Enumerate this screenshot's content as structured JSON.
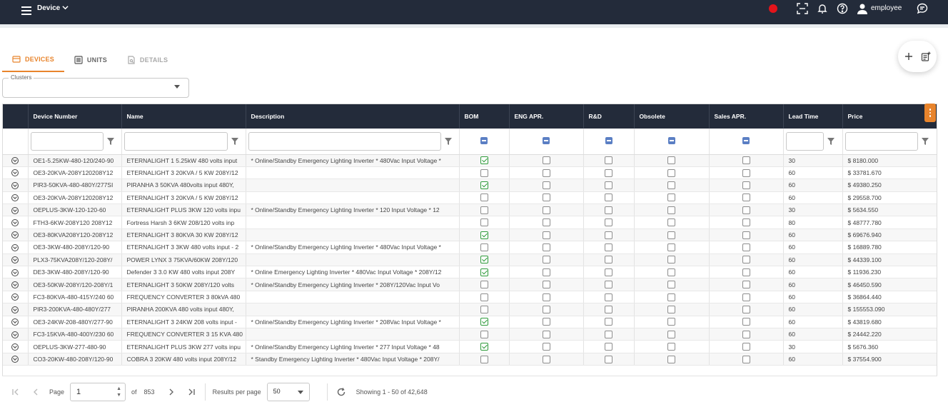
{
  "topbar": {
    "menu_label": "Device",
    "user_name": "employee"
  },
  "tabs": [
    {
      "label": "DEVICES",
      "state": "active"
    },
    {
      "label": "UNITS",
      "state": "normal"
    },
    {
      "label": "DETAILS",
      "state": "disabled"
    }
  ],
  "clusters": {
    "label": "Clusters",
    "value": ""
  },
  "columns": [
    "Device Number",
    "Name",
    "Description",
    "BOM",
    "ENG APR.",
    "R&D",
    "Obsolete",
    "Sales APR.",
    "Lead Time",
    "Price"
  ],
  "rows": [
    {
      "device": "OE1-5.25KW-480-120/240-90",
      "name": "ETERNALIGHT 1 5.25kW 480 volts input",
      "desc": "* Online/Standby Emergency Lighting Inverter * 480Vac Input Voltage *",
      "bom": true,
      "lead": "30",
      "price": "$ 8180.000"
    },
    {
      "device": "OE3-20KVA-208Y120208Y12",
      "name": "ETERNALIGHT 3 20KVA / 5 KW 208Y/12",
      "desc": "",
      "bom": false,
      "lead": "60",
      "price": "$ 33781.670"
    },
    {
      "device": "PIR3-50KVA-480-480Y/277SI",
      "name": "PIRANHA 3 50KVA 480volts input 480Y,",
      "desc": "",
      "bom": true,
      "lead": "60",
      "price": "$ 49380.250"
    },
    {
      "device": "OE3-20KVA-208Y120208Y12",
      "name": "ETERNALIGHT 3 20KVA / 5 KW 208Y/12",
      "desc": "",
      "bom": false,
      "lead": "60",
      "price": "$ 29558.700"
    },
    {
      "device": "OEPLUS-3KW-120-120-60",
      "name": "ETERNALIGHT PLUS 3KW 120 volts inpu",
      "desc": "* Online/Standby Emergency Lighting Inverter * 120 Input Voltage * 12",
      "bom": false,
      "lead": "30",
      "price": "$ 5634.550"
    },
    {
      "device": "FTH3-6KW-208Y120 208Y12",
      "name": "Fortress Harsh 3 6KW 208/120 volts inp",
      "desc": "",
      "bom": false,
      "lead": "80",
      "price": "$ 48777.780"
    },
    {
      "device": "OE3-80KVA208Y120-208Y12",
      "name": "ETERNALIGHT 3 80KVA 30 KW 208Y/12",
      "desc": "",
      "bom": true,
      "lead": "60",
      "price": "$ 69676.940"
    },
    {
      "device": "OE3-3KW-480-208Y/120-90",
      "name": "ETERNALIGHT 3 3KW 480 volts input - 2",
      "desc": "* Online/Standby Emergency Lighting Inverter * 480Vac Input Voltage *",
      "bom": false,
      "lead": "60",
      "price": "$ 16889.780"
    },
    {
      "device": "PLX3-75KVA208Y/120-208Y/",
      "name": "POWER LYNX 3 75KVA/60KW 208Y/120",
      "desc": "",
      "bom": true,
      "lead": "60",
      "price": "$ 44339.100"
    },
    {
      "device": "DE3-3KW-480-208Y/120-90",
      "name": "Defender 3 3.0 KW 480 volts input 208Y",
      "desc": "* Online Emergency Lighting Inverter * 480Vac Input Voltage * 208Y/12",
      "bom": true,
      "lead": "60",
      "price": "$ 11936.230"
    },
    {
      "device": "OE3-50KW-208Y/120-208Y/1",
      "name": "ETERNALIGHT 3 50KW 208Y/120 volts",
      "desc": "* Online/Standby Emergency Lighting Inverter * 208Y/120Vac Input Vo",
      "bom": false,
      "lead": "60",
      "price": "$ 46450.590"
    },
    {
      "device": "FC3-80KVA-480-415Y/240 60",
      "name": "FREQUENCY CONVERTER 3 80kVA 480",
      "desc": "",
      "bom": false,
      "lead": "60",
      "price": "$ 36864.440"
    },
    {
      "device": "PIR3-200KVA-480-480Y/277",
      "name": "PIRANHA 200KVA 480 volts input 480Y,",
      "desc": "",
      "bom": false,
      "lead": "60",
      "price": "$ 155553.090"
    },
    {
      "device": "OE3-24KW-208-480Y/277-90",
      "name": "ETERNALIGHT 3 24KW 208 volts input -",
      "desc": "* Online/Standby Emergency Lighting Inverter * 208Vac Input Voltage *",
      "bom": true,
      "lead": "60",
      "price": "$ 43819.680"
    },
    {
      "device": "FC3-15KVA-480-400Y/230 60",
      "name": "FREQUENCY CONVERTER 3 15 KVA 480",
      "desc": "",
      "bom": false,
      "lead": "60",
      "price": "$ 24442.220"
    },
    {
      "device": "OEPLUS-3KW-277-480-90",
      "name": "ETERNALIGHT PLUS 3KW 277 volts inpu",
      "desc": "* Online/Standby Emergency Lighting Inverter * 277 Input Voltage * 48",
      "bom": true,
      "lead": "30",
      "price": "$ 5676.360"
    },
    {
      "device": "CO3-20KW-480-208Y/120-90",
      "name": "COBRA 3 20KW 480 volts input 208Y/12",
      "desc": "* Standby Emergency Lighting Inverter * 480Vac Input Voltage * 208Y/",
      "bom": false,
      "lead": "60",
      "price": "$ 37554.900"
    }
  ],
  "pager": {
    "page_label": "Page",
    "page_value": "1",
    "of_label": "of",
    "total_pages": "853",
    "rpp_label": "Results per page",
    "rpp_value": "50",
    "showing": "Showing 1 - 50 of 42,648"
  }
}
